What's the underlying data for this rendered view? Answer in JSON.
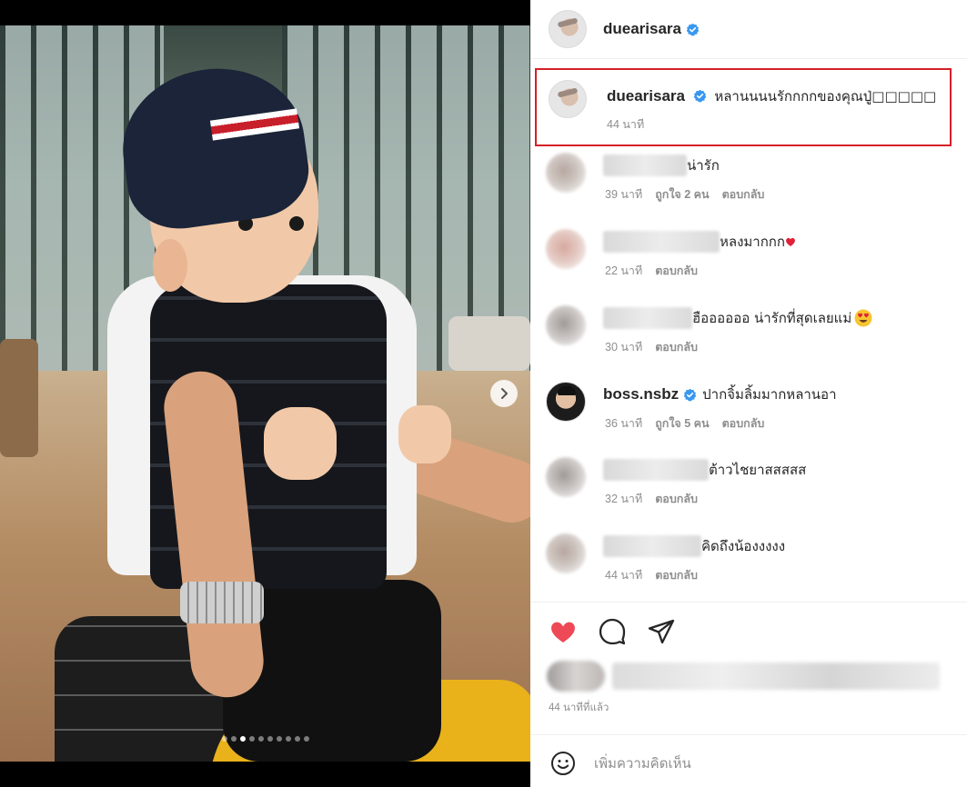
{
  "colors": {
    "accent_blue": "#3897f0",
    "like_red": "#ed4956",
    "highlight_border": "#d61f27",
    "muted_text": "#8e8e8e"
  },
  "media": {
    "carousel": {
      "total_slides": 10,
      "active_slide": 3
    },
    "next_icon": "chevron-right-icon"
  },
  "header": {
    "username": "duearisara",
    "verified_icon": "verified-badge-icon"
  },
  "caption": {
    "username": "duearisara",
    "text": "หลานนนนรักกกกของคุณปู่□□□□□",
    "time": "44 นาที"
  },
  "comments": [
    {
      "username": "",
      "text": "น่ารัก",
      "time": "39 นาที",
      "likes": "ถูกใจ 2 คน",
      "reply": "ตอบกลับ"
    },
    {
      "username": "",
      "text": "หลงมากกก",
      "emoji": "heart-emoji-icon",
      "time": "22 นาที",
      "reply": "ตอบกลับ"
    },
    {
      "username": "",
      "text": "ฮืออออออ น่ารักที่สุดเลยแม่",
      "emoji": "heart-eyes-emoji-icon",
      "time": "30 นาที",
      "reply": "ตอบกลับ"
    },
    {
      "username": "boss.nsbz",
      "verified": true,
      "text": "ปากจิ้มลิ้มมากหลานอา",
      "time": "36 นาที",
      "likes": "ถูกใจ 5 คน",
      "reply": "ตอบกลับ"
    },
    {
      "username": "",
      "text": "ต้าวไชยาสสสสส",
      "time": "32 นาที",
      "reply": "ตอบกลับ"
    },
    {
      "username": "",
      "text": "คิดถึงน้องงงงง",
      "time": "44 นาที",
      "reply": "ตอบกลับ"
    }
  ],
  "actions": {
    "like_icon": "heart-filled-icon",
    "comment_icon": "comment-icon",
    "share_icon": "share-icon",
    "liked": true
  },
  "post": {
    "posted_time": "44 นาทีที่แล้ว"
  },
  "add_comment": {
    "placeholder": "เพิ่มความคิดเห็น",
    "emoji_icon": "smiley-icon"
  }
}
